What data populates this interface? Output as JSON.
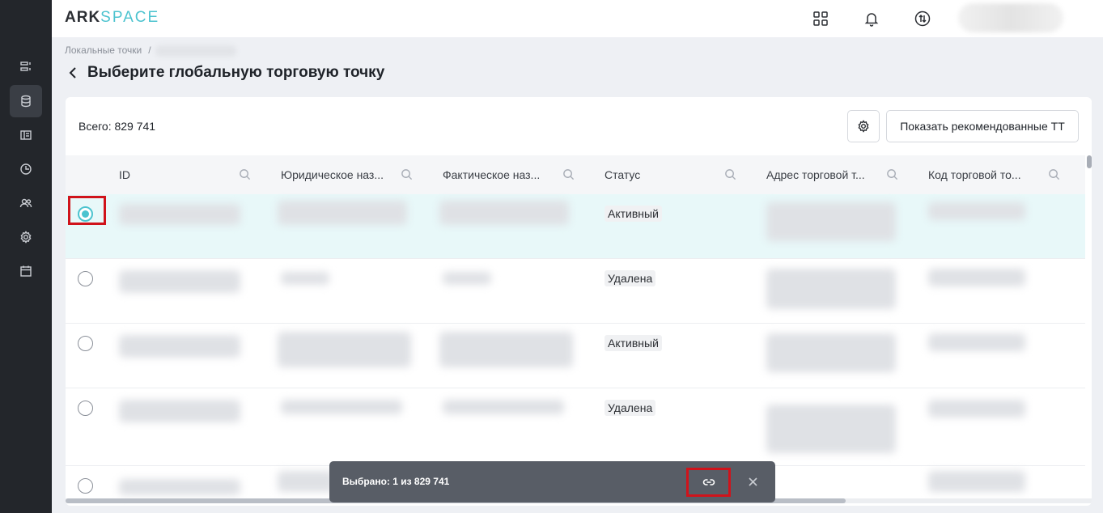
{
  "app": {
    "logo_main": "ARK",
    "logo_accent": "SPACE"
  },
  "breadcrumb": {
    "root": "Локальные точки",
    "separator": "/"
  },
  "page": {
    "title": "Выберите глобальную торговую точку"
  },
  "toolbar": {
    "total": "Всего: 829 741",
    "recommend_button": "Показать рекомендованные ТТ"
  },
  "table": {
    "columns": [
      {
        "label": "ID"
      },
      {
        "label": "Юридическое наз..."
      },
      {
        "label": "Фактическое наз..."
      },
      {
        "label": "Статус"
      },
      {
        "label": "Адрес торговой т..."
      },
      {
        "label": "Код торговой то..."
      }
    ],
    "rows": [
      {
        "status": "Активный",
        "selected": true
      },
      {
        "status": "Удалена",
        "selected": false
      },
      {
        "status": "Активный",
        "selected": false
      },
      {
        "status": "Удалена",
        "selected": false
      },
      {
        "status": "",
        "selected": false
      }
    ]
  },
  "snackbar": {
    "text": "Выбрано: 1 из 829 741"
  },
  "colors": {
    "accent": "#4cc3cf",
    "sidebar": "#23262b",
    "highlight": "#d0131b",
    "snackbar": "#585d66"
  },
  "icons": [
    "list-icon",
    "database-icon",
    "layout-icon",
    "chart-icon",
    "users-icon",
    "settings-icon",
    "calendar-icon",
    "apps-grid-icon",
    "bell-icon",
    "sync-icon",
    "back-chevron-icon",
    "gear-icon",
    "search-icon",
    "link-icon",
    "close-icon"
  ]
}
